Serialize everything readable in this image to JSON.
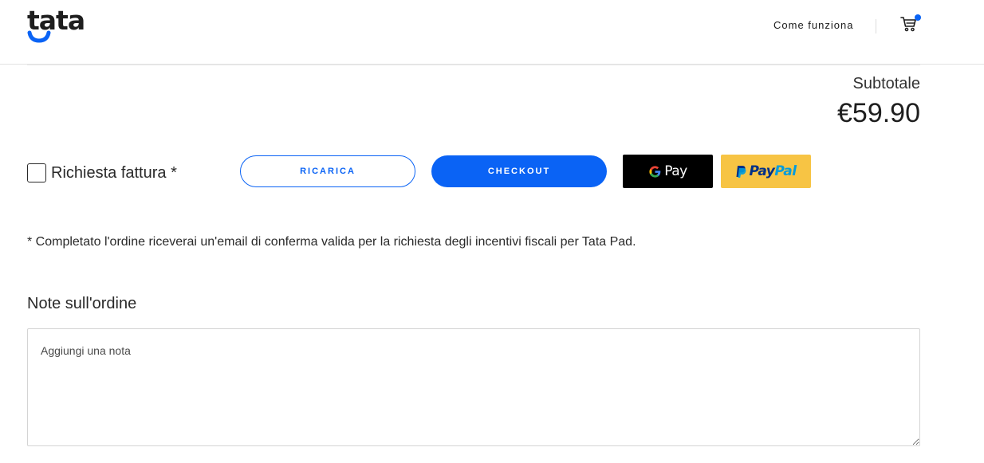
{
  "header": {
    "logo_text": "tata",
    "nav_link": "Come funziona",
    "cart_icon": "cart-icon",
    "cart_badge_color": "#0a63f5"
  },
  "summary": {
    "subtotal_label": "Subtotale",
    "subtotal_value": "€59.90"
  },
  "invoice": {
    "label": "Richiesta fattura *",
    "checked": false
  },
  "actions": {
    "recharge_label": "RICARICA",
    "checkout_label": "CHECKOUT",
    "gpay_label": "Pay",
    "paypal_label_pay": "Pay",
    "paypal_label_pal": "Pal"
  },
  "footnote": "* Completato l'ordine riceverai un'email di conferma valida per la richiesta degli incentivi fiscali per Tata Pad.",
  "notes": {
    "title": "Note sull'ordine",
    "placeholder": "Aggiungi una nota",
    "value": ""
  },
  "colors": {
    "accent": "#0a63f5",
    "paypal_bg": "#f7c444",
    "gpay_bg": "#000000"
  }
}
